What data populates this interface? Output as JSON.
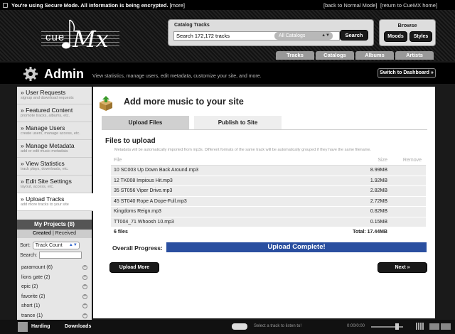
{
  "topbar": {
    "secure_text": "You're using Secure Mode. All information is being encrypted.",
    "more_link": "[more]",
    "back_link": "[back to Normal Mode]",
    "return_link": "[return to CueMX home]"
  },
  "logo": {
    "cue": "cue",
    "mx": "Mx"
  },
  "catalog": {
    "label": "Catalog Tracks",
    "search_value": "Search 172,172 tracks",
    "select_value": "All Catalogs",
    "search_button": "Search"
  },
  "browse": {
    "label": "Browse",
    "moods": "Moods",
    "styles": "Styles"
  },
  "nav_tabs": [
    "Tracks",
    "Catalogs",
    "Albums",
    "Artists"
  ],
  "admin": {
    "title": "Admin",
    "description": "View statistics, manage users, edit metadata, customize your site, and more.",
    "dashboard_button": "Switch to Dashboard »"
  },
  "sidebar": {
    "items": [
      {
        "title": "» User Requests",
        "sub": "signup and download requests"
      },
      {
        "title": "» Featured Content",
        "sub": "promote tracks, albums, etc."
      },
      {
        "title": "» Manage Users",
        "sub": "create users, manage access, etc."
      },
      {
        "title": "» Manage Metadata",
        "sub": "add or edit music metadata"
      },
      {
        "title": "» View Statistics",
        "sub": "track plays, downloads, etc."
      },
      {
        "title": "» Edit Site Settings",
        "sub": "layout, access, etc."
      },
      {
        "title": "» Upload Tracks",
        "sub": "add more tracks to your site"
      }
    ]
  },
  "projects": {
    "header": "My Projects (8)",
    "created": "Created",
    "sep": " | ",
    "received": "Received",
    "sort_label": "Sort:",
    "sort_value": "Track Count",
    "search_label": "Search:",
    "list": [
      "paramount (6)",
      "lions gate (2)",
      "epic (2)",
      "favorite (2)",
      "short (1)",
      "trance (1)"
    ]
  },
  "main": {
    "heading": "Add more music to your site",
    "tab_upload": "Upload Files",
    "tab_publish": "Publish to Site",
    "files_heading": "Files to upload",
    "note": "Metadata will be automatically imported from mp3s. Different formats of the same track will be automatically grouped if they have the same filename.",
    "col_file": "File",
    "col_size": "Size",
    "col_remove": "Remove",
    "files": [
      {
        "name": "10 SC003 Up Down Back Around.mp3",
        "size": "8.99MB"
      },
      {
        "name": "12 TK008 Impious Hit.mp3",
        "size": "1.92MB"
      },
      {
        "name": "35 ST056 Viper Drive.mp3",
        "size": "2.82MB"
      },
      {
        "name": "45 ST040 Rope A Dope-Full.mp3",
        "size": "2.72MB"
      },
      {
        "name": "Kingdoms Reign.mp3",
        "size": "0.82MB"
      },
      {
        "name": "TT004_71 Whoosh 10.mp3",
        "size": "0.15MB"
      }
    ],
    "file_count": "6 files",
    "total": "Total: 17.44MB",
    "progress_label": "Overall Progress:",
    "progress_text": "Upload Complete!",
    "progress_value": 1.0,
    "upload_more": "Upload More",
    "next": "Next »"
  },
  "bottom": {
    "username": "Harding",
    "downloads": "Downloads",
    "player_text": "Select a track to listen to!",
    "time": "0:00/0:00"
  }
}
